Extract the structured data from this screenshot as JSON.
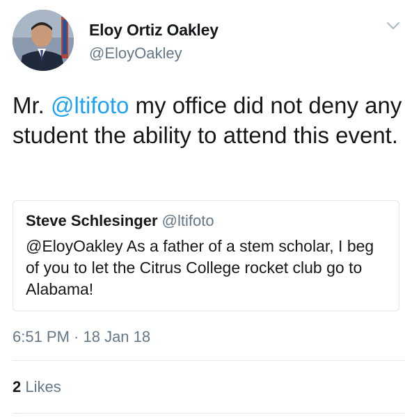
{
  "tweet": {
    "author_name": "Eloy Ortiz Oakley",
    "author_handle": "@EloyOakley",
    "avatar_icon": "avatar-photo",
    "menu_icon": "chevron-down-icon",
    "text_prefix": "Mr. ",
    "mention": "@ltifoto",
    "text_suffix": " my office did not deny any student the ability to attend this event.",
    "quoted": {
      "author_name": "Steve Schlesinger",
      "author_handle": "@ltifoto",
      "text": "@EloyOakley As a father of a stem scholar, I beg of you to let the Citrus College rocket club go to Alabama!"
    },
    "timestamp": "6:51 PM · 18 Jan 18",
    "likes_count": "2",
    "likes_label": "Likes"
  },
  "colors": {
    "text": "#14171a",
    "secondary": "#657786",
    "link": "#1da1f2",
    "border": "#e1e8ed"
  }
}
